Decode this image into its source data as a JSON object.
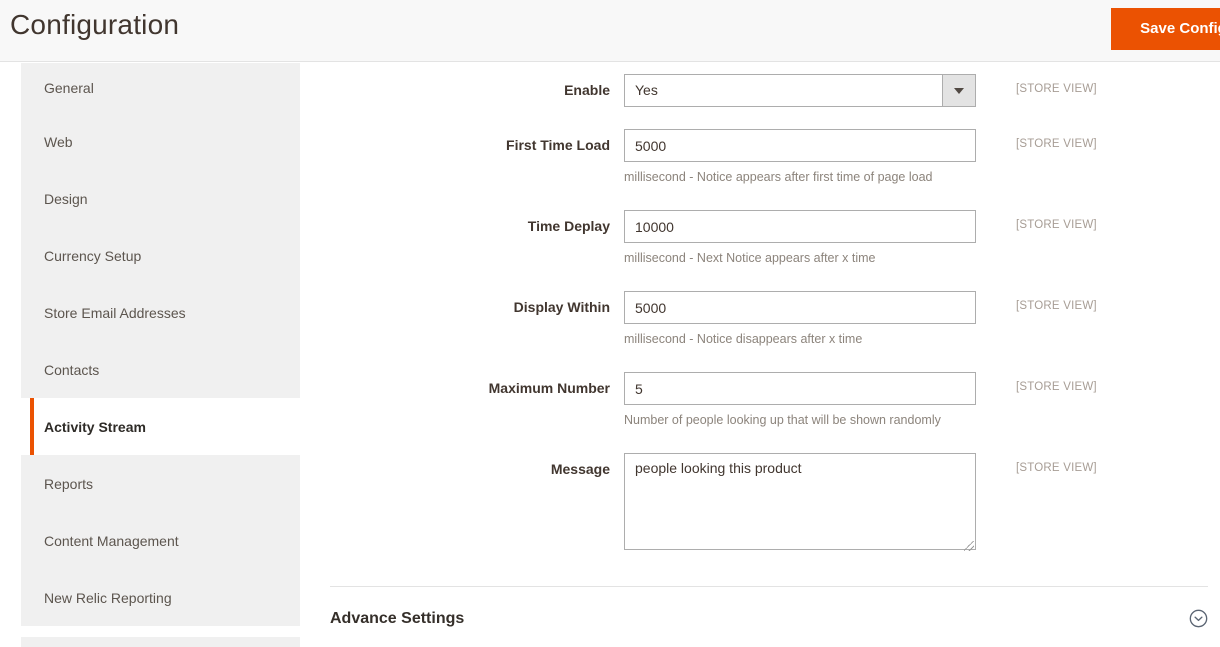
{
  "header": {
    "title": "Configuration",
    "save_button": "Save Config"
  },
  "sidebar": {
    "items": [
      {
        "label": "General",
        "active": false
      },
      {
        "label": "Web",
        "active": false
      },
      {
        "label": "Design",
        "active": false
      },
      {
        "label": "Currency Setup",
        "active": false
      },
      {
        "label": "Store Email Addresses",
        "active": false
      },
      {
        "label": "Contacts",
        "active": false
      },
      {
        "label": "Activity Stream",
        "active": true
      },
      {
        "label": "Reports",
        "active": false
      },
      {
        "label": "Content Management",
        "active": false
      },
      {
        "label": "New Relic Reporting",
        "active": false
      }
    ]
  },
  "form": {
    "fields": [
      {
        "label": "Enable",
        "type": "select",
        "value": "Yes",
        "scope": "[STORE VIEW]"
      },
      {
        "label": "First Time Load",
        "type": "text",
        "value": "5000",
        "note": "millisecond - Notice appears after first time of page load",
        "scope": "[STORE VIEW]"
      },
      {
        "label": "Time Deplay",
        "type": "text",
        "value": "10000",
        "note": "millisecond - Next Notice appears after x time",
        "scope": "[STORE VIEW]"
      },
      {
        "label": "Display Within",
        "type": "text",
        "value": "5000",
        "note": "millisecond - Notice disappears after x time",
        "scope": "[STORE VIEW]"
      },
      {
        "label": "Maximum Number",
        "type": "text",
        "value": "5",
        "note": "Number of people looking up that will be shown randomly",
        "scope": "[STORE VIEW]"
      },
      {
        "label": "Message",
        "type": "textarea",
        "value": "people looking this product",
        "scope": "[STORE VIEW]"
      }
    ],
    "advanced_section_title": "Advance Settings"
  },
  "colors": {
    "accent_orange": "#eb5202",
    "active_nav_border": "#eb5202",
    "input_border": "#adadad",
    "header_bg": "#f8f8f8",
    "sidebar_bg": "#f0f0f0",
    "note_text": "#8c847c",
    "scope_text": "#a79d95"
  },
  "icons": {
    "select_arrow": "caret-down",
    "advanced_collapse": "chevron-down-circle",
    "textarea_resize": "resize-grip"
  }
}
